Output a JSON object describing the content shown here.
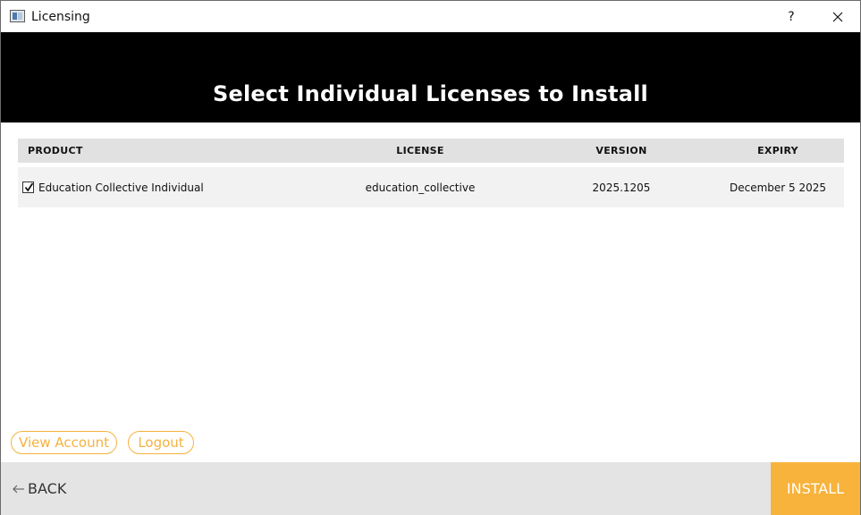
{
  "window": {
    "title": "Licensing",
    "help_label": "?"
  },
  "banner": {
    "title": "Select Individual Licenses to Install"
  },
  "table": {
    "headers": {
      "product": "PRODUCT",
      "license": "LICENSE",
      "version": "VERSION",
      "expiry": "EXPIRY"
    },
    "rows": [
      {
        "checked": true,
        "product": "Education Collective Individual",
        "license": "education_collective",
        "version": "2025.1205",
        "expiry": "December 5 2025"
      }
    ]
  },
  "links": {
    "view_account": "View Account",
    "logout": "Logout"
  },
  "footer": {
    "back_label": "BACK",
    "install_label": "INSTALL"
  },
  "colors": {
    "accent": "#f7b33c",
    "banner": "#000000",
    "footer": "#e4e4e4"
  }
}
